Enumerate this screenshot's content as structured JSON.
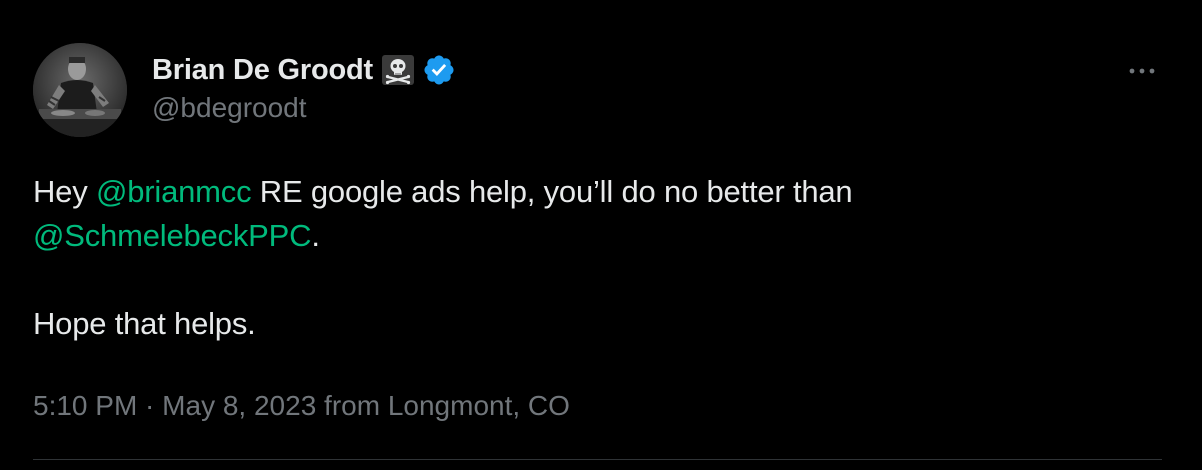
{
  "author": {
    "display_name": "Brian De Groodt",
    "handle": "@bdegroodt",
    "name_emoji": "skull-and-crossbones-icon",
    "verified": true,
    "verified_color": "#1d9bf0"
  },
  "tweet": {
    "line1_prefix": "Hey ",
    "mention1": "@brianmcc",
    "line1_suffix": " RE google ads help, you’ll do no better than",
    "mention2": "@SchmelebeckPPC",
    "line2_suffix": ".",
    "paragraph2": "Hope that helps.",
    "mention_color": "#00ba7c"
  },
  "meta": {
    "time": "5:10 PM",
    "separator": " · ",
    "date": "May 8, 2023",
    "location_text": " from Longmont, CO"
  },
  "menu": {
    "more_icon": "more-horizontal-icon"
  },
  "colors": {
    "background": "#000000",
    "text_primary": "#e7e9ea",
    "text_secondary": "#71767b",
    "divider": "#2f3336"
  }
}
